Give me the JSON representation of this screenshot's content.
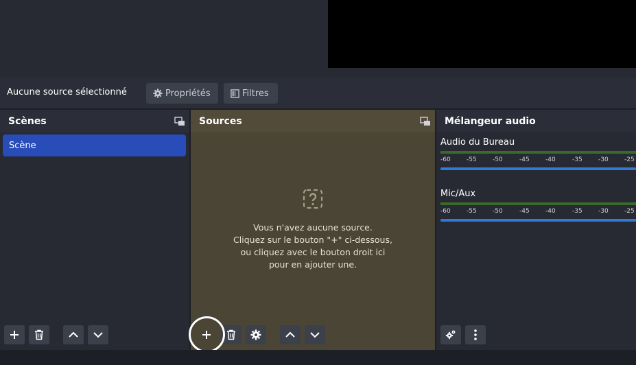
{
  "context_bar": {
    "label": "Aucune source sélectionné",
    "properties_label": "Propriétés",
    "filters_label": "Filtres"
  },
  "scenes": {
    "title": "Scènes",
    "items": [
      {
        "label": "Scène",
        "selected": true
      }
    ]
  },
  "sources": {
    "title": "Sources",
    "empty_lines": [
      "Vous n'avez aucune source.",
      "Cliquez sur le bouton \"+\" ci-dessous,",
      "ou cliquez avec le bouton droit ici",
      "pour en ajouter une."
    ]
  },
  "mixer": {
    "title": "Mélangeur audio",
    "ticks": [
      "-60",
      "-55",
      "-50",
      "-45",
      "-40",
      "-35",
      "-30",
      "-25"
    ],
    "channels": [
      {
        "name": "Audio du Bureau"
      },
      {
        "name": "Mic/Aux"
      }
    ]
  },
  "icons": {
    "add": "plus-icon",
    "remove": "trash-icon",
    "up": "chevron-up-icon",
    "down": "chevron-down-icon",
    "settings": "gear-icon",
    "more": "vertical-dots-icon",
    "float": "undock-icon",
    "empty": "question-icon"
  },
  "colors": {
    "selected_scene": "#284cb8",
    "sources_dock": "#4a4535",
    "volume": "#2f7bd9",
    "meter": "#3a6b2a"
  }
}
